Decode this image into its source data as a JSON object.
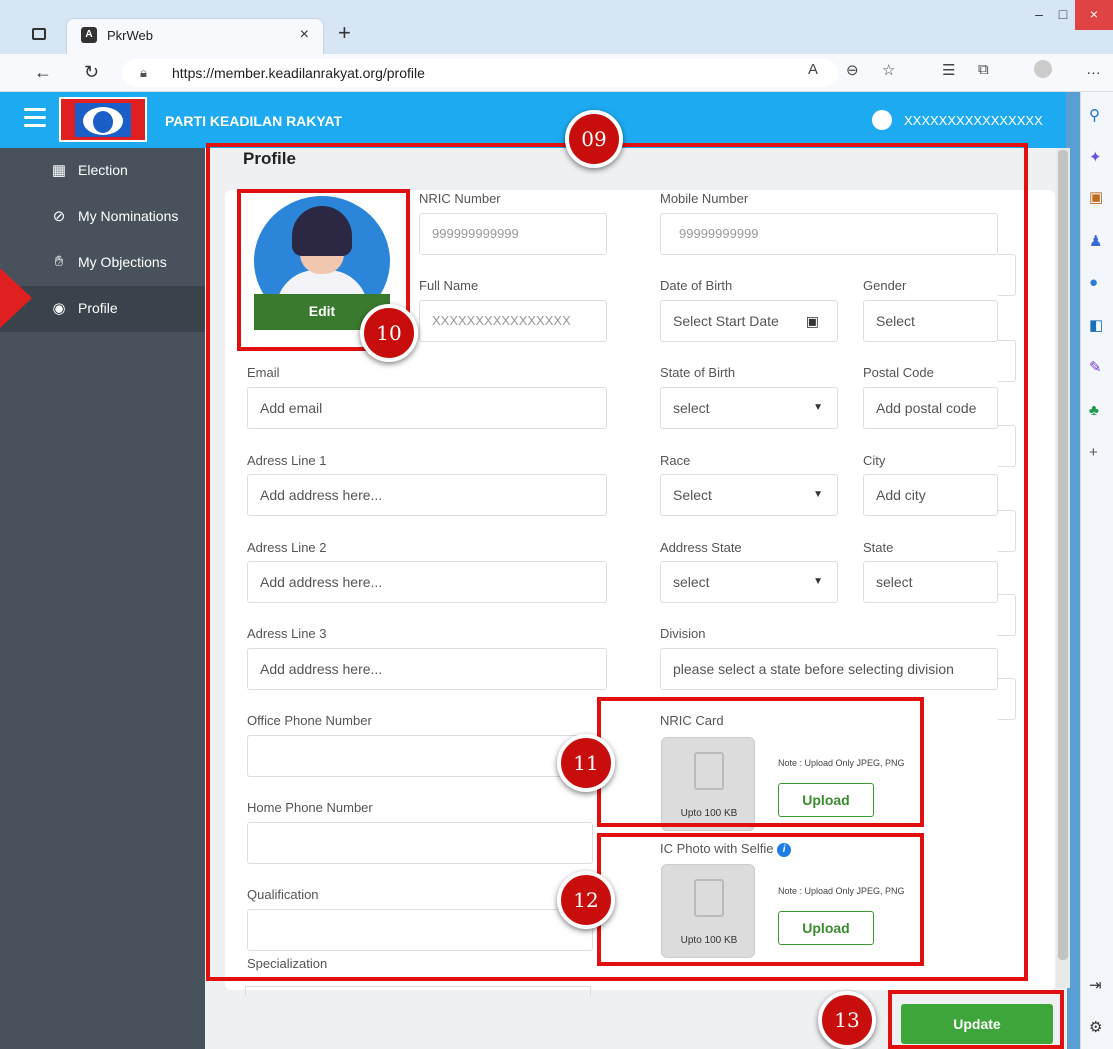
{
  "browser": {
    "tab_title": "PkrWeb",
    "tab_close": "×",
    "new_tab": "+",
    "url": "https://member.keadilanrakyat.org/profile",
    "window_buttons": [
      "–",
      "□",
      "×"
    ]
  },
  "app": {
    "brand": "PARTI KEADILAN RAKYAT",
    "username": "XXXXXXXXXXXXXXXX"
  },
  "sidebar": {
    "items": [
      {
        "label": "Election",
        "icon": "grid-icon"
      },
      {
        "label": "My Nominations",
        "icon": "check-circle-icon"
      },
      {
        "label": "My Objections",
        "icon": "hand-icon"
      },
      {
        "label": "Profile",
        "icon": "user-circle-icon",
        "active": true
      }
    ]
  },
  "profile": {
    "title": "Profile",
    "edit_label": "Edit",
    "fields": {
      "nric": {
        "label": "NRIC Number",
        "value": "999999999999"
      },
      "mobile": {
        "label": "Mobile Number",
        "value": "99999999999"
      },
      "full_name": {
        "label": "Full Name",
        "value": "XXXXXXXXXXXXXXXX"
      },
      "dob": {
        "label": "Date of Birth",
        "placeholder": "Select Start Date"
      },
      "gender": {
        "label": "Gender",
        "value": "Select"
      },
      "email": {
        "label": "Email",
        "placeholder": "Add email"
      },
      "state_of_birth": {
        "label": "State of Birth",
        "value": "select"
      },
      "postal_code": {
        "label": "Postal Code",
        "placeholder": "Add postal code"
      },
      "address1": {
        "label": "Adress Line 1",
        "placeholder": "Add address here..."
      },
      "race": {
        "label": "Race",
        "value": "Select"
      },
      "city": {
        "label": "City",
        "placeholder": "Add city"
      },
      "address2": {
        "label": "Adress Line 2",
        "placeholder": "Add address here..."
      },
      "address_state": {
        "label": "Address State",
        "value": "select"
      },
      "state": {
        "label": "State",
        "value": "select"
      },
      "address3": {
        "label": "Adress Line 3",
        "placeholder": "Add address here..."
      },
      "division": {
        "label": "Division",
        "value": "please select a state before selecting division"
      },
      "office_phone": {
        "label": "Office Phone Number",
        "value": ""
      },
      "home_phone": {
        "label": "Home Phone Number",
        "value": ""
      },
      "qualification": {
        "label": "Qualification",
        "value": ""
      },
      "specialization": {
        "label": "Specialization",
        "value": ""
      }
    },
    "uploads": {
      "nric_card": {
        "label": "NRIC Card",
        "size": "Upto 100 KB",
        "note": "Note : Upload Only JPEG, PNG",
        "button": "Upload"
      },
      "selfie": {
        "label": "IC Photo with Selfie",
        "size": "Upto 100 KB",
        "note": "Note : Upload Only JPEG, PNG",
        "button": "Upload"
      }
    },
    "update_label": "Update"
  },
  "annotations": [
    "09",
    "10",
    "11",
    "12",
    "13"
  ],
  "colors": {
    "header": "#1eaaf1",
    "sidebar": "#48525d",
    "annotation": "#e01010",
    "update_button": "#3da53a"
  }
}
